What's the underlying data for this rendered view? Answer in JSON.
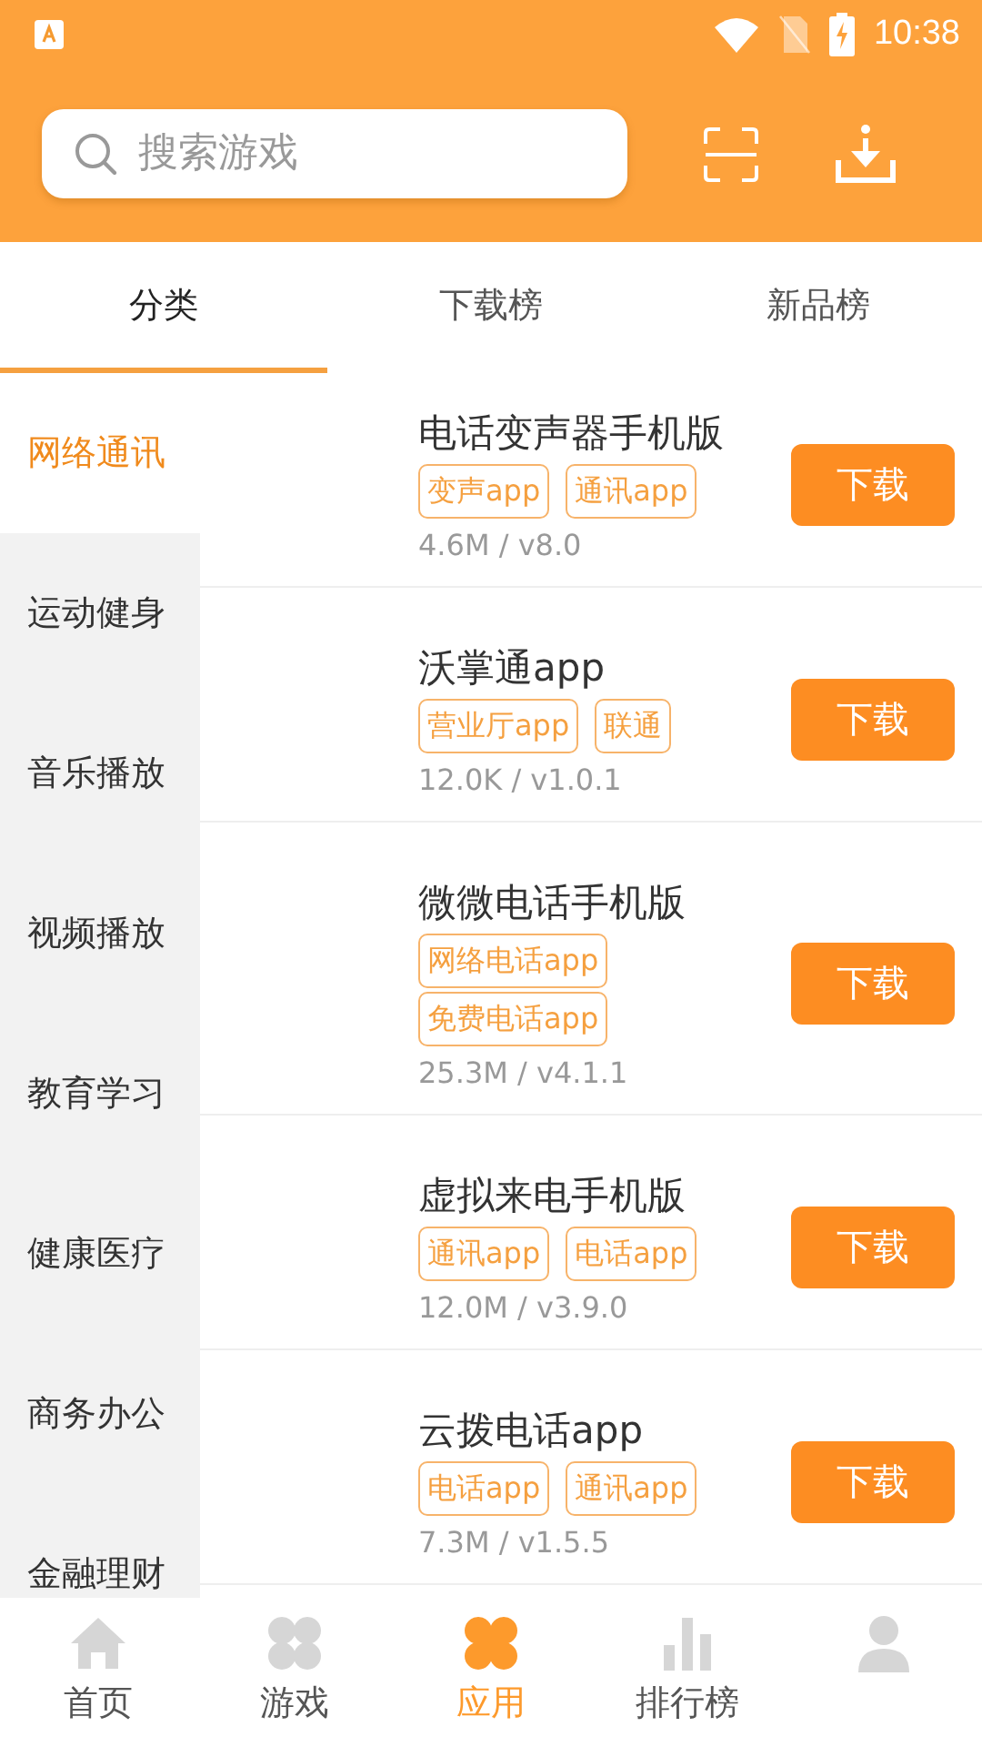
{
  "status_bar": {
    "time": "10:38"
  },
  "search": {
    "placeholder": "搜索游戏"
  },
  "tabs": [
    {
      "label": "分类",
      "selected": true
    },
    {
      "label": "下载榜",
      "selected": false
    },
    {
      "label": "新品榜",
      "selected": false
    }
  ],
  "categories": [
    {
      "label": "网络通讯",
      "selected": true
    },
    {
      "label": "运动健身",
      "selected": false
    },
    {
      "label": "音乐播放",
      "selected": false
    },
    {
      "label": "视频播放",
      "selected": false
    },
    {
      "label": "教育学习",
      "selected": false
    },
    {
      "label": "健康医疗",
      "selected": false
    },
    {
      "label": "商务办公",
      "selected": false
    },
    {
      "label": "金融理财",
      "selected": false
    }
  ],
  "apps": [
    {
      "name": "电话变声器手机版",
      "tags": [
        "变声app",
        "通讯app"
      ],
      "meta": "4.6M / v8.0",
      "button": "下载"
    },
    {
      "name": "沃掌通app",
      "tags": [
        "营业厅app",
        "联通"
      ],
      "meta": "12.0K / v1.0.1",
      "button": "下载"
    },
    {
      "name": "微微电话手机版",
      "tags": [
        "网络电话app",
        "免费电话app"
      ],
      "meta": "25.3M / v4.1.1",
      "button": "下载"
    },
    {
      "name": "虚拟来电手机版",
      "tags": [
        "通讯app",
        "电话app"
      ],
      "meta": "12.0M / v3.9.0",
      "button": "下载"
    },
    {
      "name": "云拨电话app",
      "tags": [
        "电话app",
        "通讯app"
      ],
      "meta": "7.3M / v1.5.5",
      "button": "下载"
    }
  ],
  "bottom_nav": [
    {
      "kind": "home",
      "label": "首页",
      "selected": false
    },
    {
      "kind": "games",
      "label": "游戏",
      "selected": false
    },
    {
      "kind": "apps",
      "label": "应用",
      "selected": true
    },
    {
      "kind": "ranking",
      "label": "排行榜",
      "selected": false
    },
    {
      "kind": "profile",
      "selected": false
    }
  ]
}
